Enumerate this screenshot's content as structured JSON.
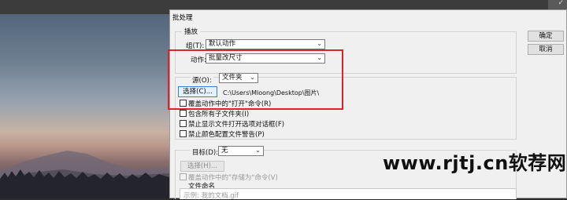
{
  "dialog": {
    "title": "批处理",
    "ok_label": "确定",
    "cancel_label": "取消"
  },
  "play": {
    "legend": "播放",
    "set_label": "组(T):",
    "set_value": "默认动作",
    "action_label": "动作:",
    "action_value": "批量改尺寸"
  },
  "source": {
    "label": "源(O):",
    "value": "文件夹",
    "choose_label": "选择(C)...",
    "path": "C:\\Users\\Mloong\\Desktop\\图片\\",
    "options": [
      "覆盖动作中的\"打开\"命令(R)",
      "包含所有子文件夹(I)",
      "禁止显示文件打开选项对话框(F)",
      "禁止颜色配置文件警告(P)"
    ]
  },
  "destination": {
    "label": "目标(D):",
    "value": "无",
    "choose_label": "选择(H)...",
    "override_save": "覆盖动作中的\"存储为\"命令(V)",
    "file_naming_label": "文件命名",
    "example": "示例: 我的文档.gif"
  },
  "watermark": "www.rjtj.cn软荐网",
  "colors": {
    "highlight": "#d6262b",
    "dialog_bg": "#f0f0f0",
    "focus_border": "#3d7bd6"
  }
}
